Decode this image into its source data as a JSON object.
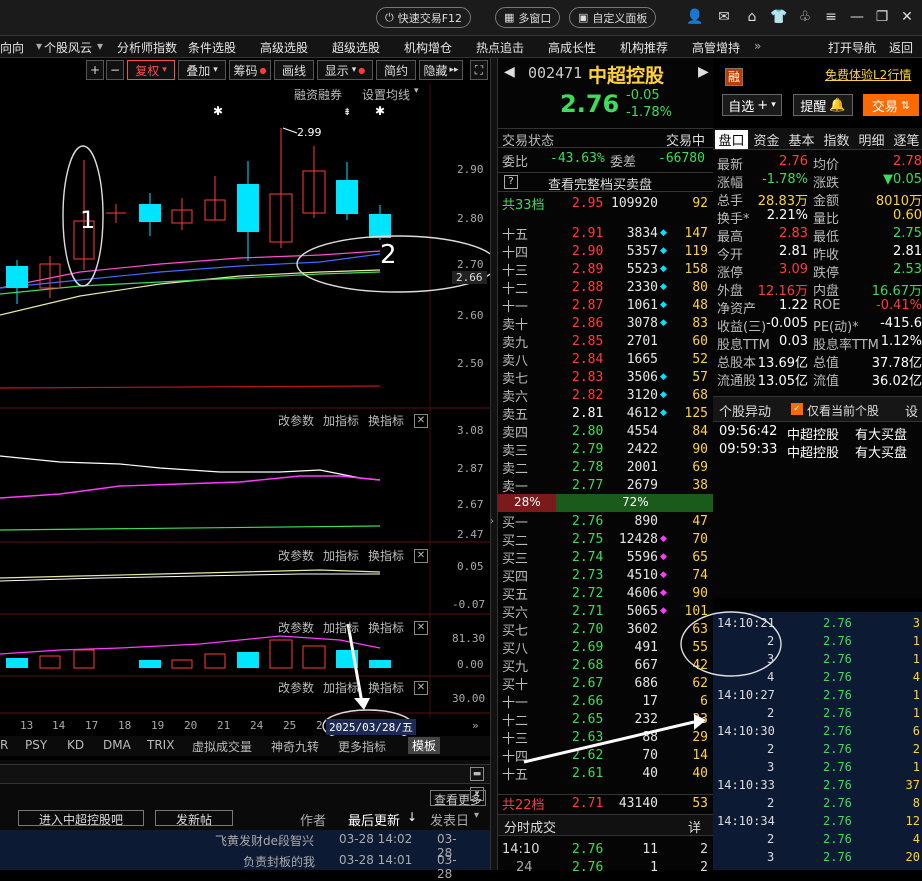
{
  "topbar": {
    "quick_trade": "快速交易F12",
    "multi_window": "多窗口",
    "custom_panel": "自定义面板"
  },
  "menu": [
    "向向",
    "个股风云",
    "分析师指数",
    "条件选股",
    "高级选股",
    "超级选股",
    "机构增仓",
    "热点追击",
    "高成长性",
    "机构推荐",
    "高管增持",
    "»",
    "打开导航",
    "返回"
  ],
  "chart_toolbar": {
    "plus": "+",
    "minus": "−",
    "restore": "复权",
    "overlay": "叠加",
    "chips": "筹码",
    "draw": "画线",
    "display": "显示",
    "brief": "简约",
    "hide": "隐藏"
  },
  "chart_links": {
    "margin": "融资融券",
    "ma_setting": "设置均线"
  },
  "price_axis": [
    "2.90",
    "2.80",
    "2.70",
    "2.66",
    "2.60",
    "2.50"
  ],
  "peak_label": "2.99",
  "annotations": {
    "one": "1",
    "two": "2"
  },
  "panel2": {
    "tools": [
      "改参数",
      "加指标",
      "换指标"
    ],
    "axis": [
      "3.08",
      "2.87",
      "2.67",
      "2.47"
    ]
  },
  "panel3": {
    "tools": [
      "改参数",
      "加指标",
      "换指标"
    ],
    "axis": [
      "0.05",
      "-0.07"
    ]
  },
  "panel4": {
    "tools": [
      "改参数",
      "加指标",
      "换指标"
    ],
    "axis": [
      "81.30",
      "0.00"
    ]
  },
  "panel5": {
    "tools": [
      "改参数",
      "加指标",
      "换指标"
    ],
    "axis": [
      "30.00"
    ]
  },
  "x_axis": [
    "13",
    "14",
    "17",
    "18",
    "19",
    "20",
    "21",
    "24",
    "25",
    "2"
  ],
  "cursor_date": "2025/03/28/五",
  "indicator_tabs": [
    "R",
    "PSY",
    "KD",
    "DMA",
    "TRIX",
    "虚拟成交量",
    "神奇九转",
    "更多指标",
    "模板"
  ],
  "bottom": {
    "see_more": "查看更多",
    "enter_bar": "进入中超控股吧",
    "post": "发新帖",
    "author": "作者",
    "last_update": "最后更新",
    "post_date": "发表日",
    "posts": [
      {
        "title": "飞黄发财de段智兴",
        "time": "03-28 14:02",
        "date": "03-28"
      },
      {
        "title": "负责封板的我",
        "time": "03-28 14:01",
        "date": "03-28"
      }
    ]
  },
  "stock": {
    "code": "002471",
    "name": "中超控股",
    "tag": "融",
    "free_trial": "免费体验L2行情",
    "price": "2.76",
    "change": "-0.05",
    "pct": "-1.78%",
    "watch": "自选",
    "alert": "提醒",
    "trade": "交易"
  },
  "book": {
    "status_label": "交易状态",
    "status": "交易中",
    "ratio_label": "委比",
    "ratio": "-43.63%",
    "diff_label": "委差",
    "diff": "-66780",
    "full_link": "查看完整档买卖盘",
    "ask_total": {
      "label": "共33档",
      "price": "2.95",
      "vol": "109920",
      "cnt": "92"
    },
    "asks": [
      [
        "十五",
        "2.91",
        "3834",
        "147"
      ],
      [
        "十四",
        "2.90",
        "5357",
        "119"
      ],
      [
        "十三",
        "2.89",
        "5523",
        "158"
      ],
      [
        "十二",
        "2.88",
        "2330",
        "80"
      ],
      [
        "十一",
        "2.87",
        "1061",
        "48"
      ],
      [
        "卖十",
        "2.86",
        "3078",
        "83"
      ],
      [
        "卖九",
        "2.85",
        "2701",
        "60"
      ],
      [
        "卖八",
        "2.84",
        "1665",
        "52"
      ],
      [
        "卖七",
        "2.83",
        "3506",
        "57"
      ],
      [
        "卖六",
        "2.82",
        "3120",
        "68"
      ],
      [
        "卖五",
        "2.81",
        "4612",
        "125"
      ],
      [
        "卖四",
        "2.80",
        "4554",
        "84"
      ],
      [
        "卖三",
        "2.79",
        "2422",
        "90"
      ],
      [
        "卖二",
        "2.78",
        "2001",
        "69"
      ],
      [
        "卖一",
        "2.77",
        "2679",
        "38"
      ]
    ],
    "buy_pct": "28%",
    "sell_pct": "72%",
    "bids": [
      [
        "买一",
        "2.76",
        "890",
        "47"
      ],
      [
        "买二",
        "2.75",
        "12428",
        "70"
      ],
      [
        "买三",
        "2.74",
        "5596",
        "65"
      ],
      [
        "买四",
        "2.73",
        "4510",
        "74"
      ],
      [
        "买五",
        "2.72",
        "4606",
        "90"
      ],
      [
        "买六",
        "2.71",
        "5065",
        "101"
      ],
      [
        "买七",
        "2.70",
        "3602",
        "63"
      ],
      [
        "买八",
        "2.69",
        "491",
        "55"
      ],
      [
        "买九",
        "2.68",
        "667",
        "42"
      ],
      [
        "买十",
        "2.67",
        "686",
        "62"
      ],
      [
        "十一",
        "2.66",
        "17",
        "6"
      ],
      [
        "十二",
        "2.65",
        "232",
        "33"
      ],
      [
        "十三",
        "2.63",
        "88",
        "29"
      ],
      [
        "十四",
        "2.62",
        "70",
        "14"
      ],
      [
        "十五",
        "2.61",
        "40",
        "40"
      ]
    ],
    "bid_total": {
      "label": "共22档",
      "price": "2.71",
      "vol": "43140",
      "cnt": "53"
    },
    "minute_label": "分时成交",
    "detail": "详",
    "minute": [
      [
        "14:10",
        "2.76",
        "11",
        "2"
      ],
      [
        "24",
        "2.76",
        "1",
        "2"
      ]
    ]
  },
  "info_tabs": [
    "盘口",
    "资金",
    "基本",
    "指数",
    "明细",
    "逐笔"
  ],
  "quote": [
    [
      "最新",
      "2.76",
      "均价",
      "2.78"
    ],
    [
      "涨幅",
      "-1.78%",
      "涨跌",
      "▼0.05"
    ],
    [
      "总手",
      "28.83万",
      "金额",
      "8010万"
    ],
    [
      "换手*",
      "2.21%",
      "量比",
      "0.60"
    ],
    [
      "最高",
      "2.83",
      "最低",
      "2.75"
    ],
    [
      "今开",
      "2.81",
      "昨收",
      "2.81"
    ],
    [
      "涨停",
      "3.09",
      "跌停",
      "2.53"
    ],
    [
      "外盘",
      "12.16万",
      "内盘",
      "16.67万"
    ],
    [
      "净资产",
      "1.22",
      "ROE",
      "-0.41%"
    ],
    [
      "收益(三)",
      "-0.005",
      "PE(动)*",
      "-415.6"
    ],
    [
      "股息TTM",
      "0.03",
      "股息率TTM",
      "1.12%"
    ],
    [
      "总股本",
      "13.69亿",
      "总值",
      "37.78亿"
    ],
    [
      "流通股",
      "13.05亿",
      "流值",
      "36.02亿"
    ]
  ],
  "movement": {
    "title": "个股异动",
    "only_current": "仅看当前个股",
    "setting": "设",
    "items": [
      [
        "09:56:42",
        "中超控股",
        "有大买盘"
      ],
      [
        "09:59:33",
        "中超控股",
        "有大买盘"
      ]
    ]
  },
  "ticks": [
    [
      "14:10:21",
      "2.76",
      "3"
    ],
    [
      "2",
      "2.76",
      "1"
    ],
    [
      "3",
      "2.76",
      "1"
    ],
    [
      "4",
      "2.76",
      "4"
    ],
    [
      "14:10:27",
      "2.76",
      "1"
    ],
    [
      "2",
      "2.76",
      "1"
    ],
    [
      "14:10:30",
      "2.76",
      "6"
    ],
    [
      "2",
      "2.76",
      "2"
    ],
    [
      "3",
      "2.76",
      "1"
    ],
    [
      "14:10:33",
      "2.76",
      "37"
    ],
    [
      "2",
      "2.76",
      "8"
    ],
    [
      "14:10:34",
      "2.76",
      "12"
    ],
    [
      "2",
      "2.76",
      "4"
    ],
    [
      "3",
      "2.76",
      "20"
    ]
  ],
  "colors": {
    "up": "#ff3b3b",
    "down": "#00e5ff",
    "green": "#3ddc5a",
    "yellow": "#ffd23c",
    "accent": "#ff6a00"
  }
}
